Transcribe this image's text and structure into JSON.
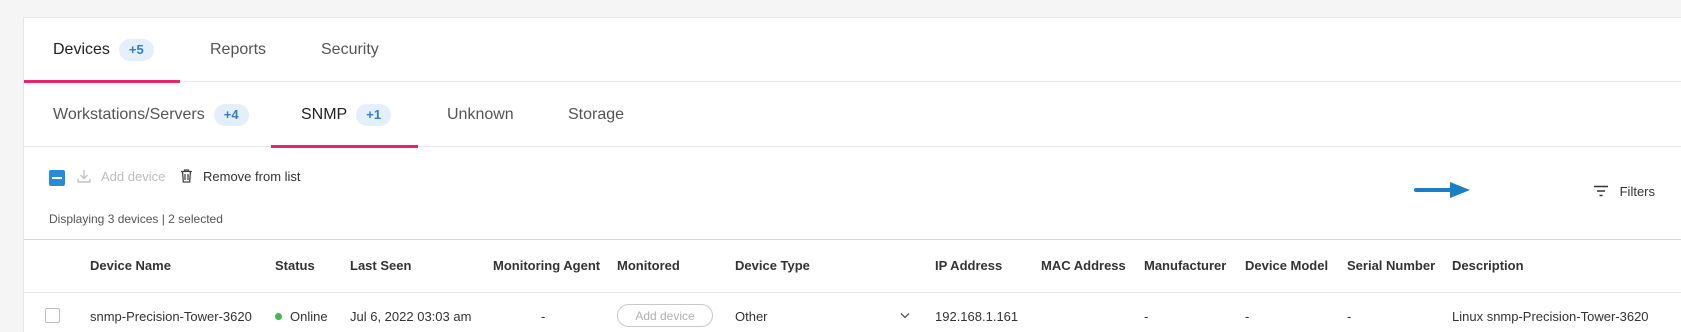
{
  "main_tabs": [
    {
      "label": "Devices",
      "badge": "+5",
      "active": true
    },
    {
      "label": "Reports"
    },
    {
      "label": "Security"
    }
  ],
  "sub_tabs": [
    {
      "label": "Workstations/Servers",
      "badge": "+4"
    },
    {
      "label": "SNMP",
      "badge": "+1",
      "active": true
    },
    {
      "label": "Unknown"
    },
    {
      "label": "Storage"
    }
  ],
  "toolbar": {
    "add_device_label": "Add device",
    "remove_label": "Remove from list",
    "display_info": "Displaying 3 devices | 2 selected",
    "filters_label": "Filters"
  },
  "table": {
    "columns": [
      "Device Name",
      "Status",
      "Last Seen",
      "Monitoring Agent",
      "Monitored",
      "Device Type",
      "IP Address",
      "MAC Address",
      "Manufacturer",
      "Device Model",
      "Serial Number",
      "Description"
    ],
    "rows": [
      {
        "device_name": "snmp-Precision-Tower-3620",
        "status": "Online",
        "last_seen": "Jul 6, 2022 03:03 am",
        "monitoring_agent": "-",
        "monitored_button": "Add device",
        "device_type": "Other",
        "ip_address": "192.168.1.161",
        "mac_address": "",
        "manufacturer": "-",
        "device_model": "-",
        "serial_number": "-",
        "description": "Linux snmp-Precision-Tower-3620"
      }
    ]
  },
  "colors": {
    "accent": "#e8266d",
    "badge_bg": "#e3f0fb",
    "badge_text": "#2f7fc6",
    "checkbox": "#2b8ad6",
    "status_online": "#3dbb4c",
    "arrow": "#1a7fc4"
  }
}
